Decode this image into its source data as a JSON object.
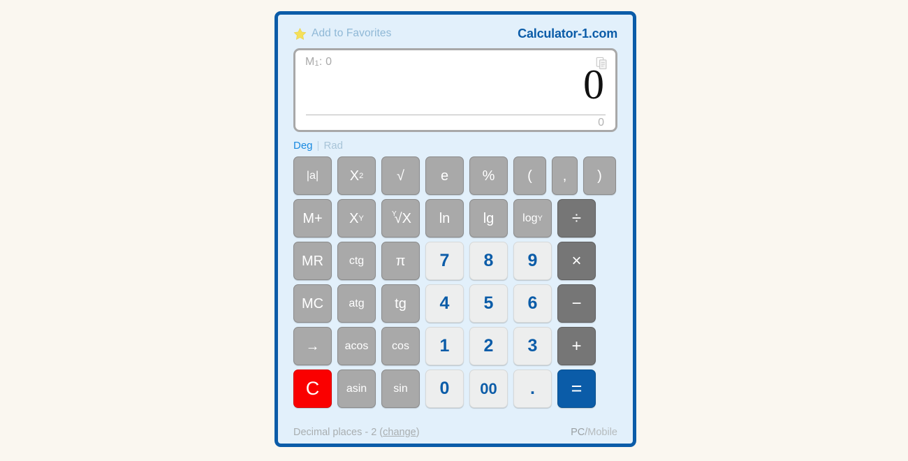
{
  "page": {
    "background_color": "#faf7f0",
    "frame_border_color": "#0b5ca8",
    "frame_background_color": "#e2f0fb"
  },
  "header": {
    "favorites_label": "Add to Favorites",
    "star_icon": "star-icon",
    "brand": "Calculator-1.com"
  },
  "display": {
    "memory_label": "M",
    "memory_index": "1",
    "memory_separator": ": ",
    "memory_value": "0",
    "copy_icon": "copy-icon",
    "main_value": "0",
    "sub_value": "0"
  },
  "angle_mode": {
    "active": "Deg",
    "separator": "|",
    "inactive": "Rad"
  },
  "keypad": {
    "rows": [
      [
        {
          "label": "|a|",
          "type": "fn",
          "name": "abs"
        },
        {
          "label": "X",
          "sup": "2",
          "type": "fn",
          "name": "square"
        },
        {
          "label": "√",
          "type": "fn",
          "name": "sqrt"
        },
        {
          "label": "e",
          "type": "fn",
          "name": "euler"
        },
        {
          "label": "%",
          "type": "fn",
          "name": "percent"
        },
        {
          "label": "(",
          "type": "fn",
          "name": "paren-open",
          "width": "wide"
        },
        {
          "label": ",",
          "type": "fn",
          "name": "comma",
          "width": "narrow"
        },
        {
          "label": ")",
          "type": "fn",
          "name": "paren-close",
          "width": "wide"
        }
      ],
      [
        {
          "label": "M+",
          "type": "fn",
          "name": "memory-add"
        },
        {
          "label": "X",
          "sup": "Y",
          "type": "fn",
          "name": "power"
        },
        {
          "label": "√X",
          "idx": "Y",
          "type": "fn",
          "name": "nth-root"
        },
        {
          "label": "ln",
          "type": "fn",
          "name": "ln"
        },
        {
          "label": "lg",
          "type": "fn",
          "name": "lg"
        },
        {
          "label": "log",
          "sub": "Y",
          "type": "fn",
          "name": "log-base-y"
        },
        {
          "label": "÷",
          "type": "op",
          "name": "divide"
        }
      ],
      [
        {
          "label": "MR",
          "type": "fn",
          "name": "memory-recall"
        },
        {
          "label": "ctg",
          "type": "fn",
          "name": "cotangent"
        },
        {
          "label": "π",
          "type": "fn",
          "name": "pi"
        },
        {
          "label": "7",
          "type": "num",
          "name": "digit-7"
        },
        {
          "label": "8",
          "type": "num",
          "name": "digit-8"
        },
        {
          "label": "9",
          "type": "num",
          "name": "digit-9"
        },
        {
          "label": "×",
          "type": "op",
          "name": "multiply"
        }
      ],
      [
        {
          "label": "MC",
          "type": "fn",
          "name": "memory-clear"
        },
        {
          "label": "atg",
          "type": "fn",
          "name": "arctangent"
        },
        {
          "label": "tg",
          "type": "fn",
          "name": "tangent"
        },
        {
          "label": "4",
          "type": "num",
          "name": "digit-4"
        },
        {
          "label": "5",
          "type": "num",
          "name": "digit-5"
        },
        {
          "label": "6",
          "type": "num",
          "name": "digit-6"
        },
        {
          "label": "−",
          "type": "op",
          "name": "minus"
        }
      ],
      [
        {
          "label": "→",
          "type": "fn",
          "name": "backspace"
        },
        {
          "label": "acos",
          "type": "fn",
          "name": "arccosine"
        },
        {
          "label": "cos",
          "type": "fn",
          "name": "cosine"
        },
        {
          "label": "1",
          "type": "num",
          "name": "digit-1"
        },
        {
          "label": "2",
          "type": "num",
          "name": "digit-2"
        },
        {
          "label": "3",
          "type": "num",
          "name": "digit-3"
        },
        {
          "label": "+",
          "type": "op",
          "name": "plus"
        }
      ],
      [
        {
          "label": "C",
          "type": "clear",
          "name": "clear"
        },
        {
          "label": "asin",
          "type": "fn",
          "name": "arcsine"
        },
        {
          "label": "sin",
          "type": "fn",
          "name": "sine"
        },
        {
          "label": "0",
          "type": "num",
          "name": "digit-0"
        },
        {
          "label": "00",
          "type": "num",
          "name": "digit-double-zero"
        },
        {
          "label": ".",
          "type": "num",
          "name": "decimal-point"
        },
        {
          "label": "=",
          "type": "eq",
          "name": "equals"
        }
      ]
    ]
  },
  "footer": {
    "decimal_places_text": "Decimal places - 2 (",
    "change_link": "change",
    "decimal_places_close": ")",
    "pc_label": "PC",
    "slash": "/",
    "mobile_label": "Mobile"
  }
}
